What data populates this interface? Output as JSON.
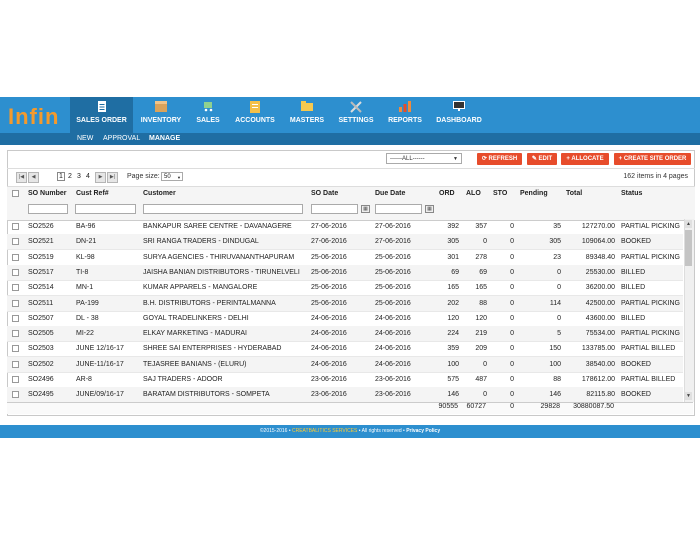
{
  "app": {
    "logo": "Infin"
  },
  "nav": {
    "items": [
      {
        "label": "SALES ORDER",
        "icon": "document-icon",
        "active": true
      },
      {
        "label": "INVENTORY",
        "icon": "box-icon",
        "active": false
      },
      {
        "label": "SALES",
        "icon": "cart-icon",
        "active": false
      },
      {
        "label": "ACCOUNTS",
        "icon": "ledger-icon",
        "active": false
      },
      {
        "label": "MASTERS",
        "icon": "folder-icon",
        "active": false
      },
      {
        "label": "SETTINGS",
        "icon": "tools-icon",
        "active": false
      },
      {
        "label": "REPORTS",
        "icon": "bar-chart-icon",
        "active": false
      },
      {
        "label": "DASHBOARD",
        "icon": "monitor-icon",
        "active": false
      }
    ]
  },
  "subnav": {
    "items": [
      "NEW",
      "APPROVAL",
      "MANAGE"
    ],
    "active": "MANAGE"
  },
  "toolbar": {
    "filter_value": "------ALL------",
    "refresh_label": "REFRESH",
    "edit_label": "EDIT",
    "allocate_label": "ALLOCATE",
    "create_label": "CREATE SITE ORDER"
  },
  "pager": {
    "pages": [
      "1",
      "2",
      "3",
      "4"
    ],
    "current": "1",
    "page_size_label": "Page size:",
    "page_size": "50",
    "items_info": "162 items in 4 pages"
  },
  "grid": {
    "columns": [
      "SO Number",
      "Cust Ref#",
      "Customer",
      "SO Date",
      "Due Date",
      "ORD",
      "ALO",
      "STO",
      "Pending",
      "Total",
      "Status"
    ],
    "rows": [
      [
        "SO2526",
        "BA-96",
        "BANKAPUR SAREE CENTRE - DAVANAGERE",
        "27-06-2016",
        "27-06-2016",
        "392",
        "357",
        "0",
        "35",
        "127270.00",
        "PARTIAL PICKING"
      ],
      [
        "SO2521",
        "DN-21",
        "SRI RANGA TRADERS - DINDUGAL",
        "27-06-2016",
        "27-06-2016",
        "305",
        "0",
        "0",
        "305",
        "109064.00",
        "BOOKED"
      ],
      [
        "SO2519",
        "KL-98",
        "SURYA AGENCIES - THIRUVANANTHAPURAM",
        "25-06-2016",
        "25-06-2016",
        "301",
        "278",
        "0",
        "23",
        "89348.40",
        "PARTIAL PICKING"
      ],
      [
        "SO2517",
        "TI-8",
        "JAISHA BANIAN DISTRIBUTORS - TIRUNELVELI",
        "25-06-2016",
        "25-06-2016",
        "69",
        "69",
        "0",
        "0",
        "25530.00",
        "BILLED"
      ],
      [
        "SO2514",
        "MN-1",
        "KUMAR APPARELS - MANGALORE",
        "25-06-2016",
        "25-06-2016",
        "165",
        "165",
        "0",
        "0",
        "36200.00",
        "BILLED"
      ],
      [
        "SO2511",
        "PA-199",
        "B.H. DISTRIBUTORS - PERINTALMANNA",
        "25-06-2016",
        "25-06-2016",
        "202",
        "88",
        "0",
        "114",
        "42500.00",
        "PARTIAL PICKING"
      ],
      [
        "SO2507",
        "DL - 38",
        "GOYAL TRADELINKERS - DELHI",
        "24-06-2016",
        "24-06-2016",
        "120",
        "120",
        "0",
        "0",
        "43600.00",
        "BILLED"
      ],
      [
        "SO2505",
        "MI-22",
        "ELKAY MARKETING - MADURAI",
        "24-06-2016",
        "24-06-2016",
        "224",
        "219",
        "0",
        "5",
        "75534.00",
        "PARTIAL PICKING"
      ],
      [
        "SO2503",
        "JUNE 12/16-17",
        "SHREE SAI ENTERPRISES - HYDERABAD",
        "24-06-2016",
        "24-06-2016",
        "359",
        "209",
        "0",
        "150",
        "133785.00",
        "PARTIAL BILLED"
      ],
      [
        "SO2502",
        "JUNE-11/16-17",
        "TEJASREE BANIANS - (ELURU)",
        "24-06-2016",
        "24-06-2016",
        "100",
        "0",
        "0",
        "100",
        "38540.00",
        "BOOKED"
      ],
      [
        "SO2496",
        "AR-8",
        "SAJ TRADERS - ADOOR",
        "23-06-2016",
        "23-06-2016",
        "575",
        "487",
        "0",
        "88",
        "178612.00",
        "PARTIAL BILLED"
      ],
      [
        "SO2495",
        "JUNE/09/16-17",
        "BARATAM DISTRIBUTORS - SOMPETA",
        "23-06-2016",
        "23-06-2016",
        "146",
        "0",
        "0",
        "146",
        "82115.80",
        "BOOKED"
      ]
    ],
    "totals": {
      "ord": "90555",
      "alo": "60727",
      "sto": "0",
      "pending": "29828",
      "total": "30880087.50"
    }
  },
  "footer": {
    "copyright": "©2015-2016 •",
    "brand": "CREATBALITICS SERVICES",
    "rights": "• All rights reserved •",
    "privacy": "Privacy Policy"
  },
  "colors": {
    "nav_bg": "#2d8fcf",
    "nav_active": "#1f6ea3",
    "accent_button": "#e74c2b",
    "logo": "#f39a2d"
  }
}
